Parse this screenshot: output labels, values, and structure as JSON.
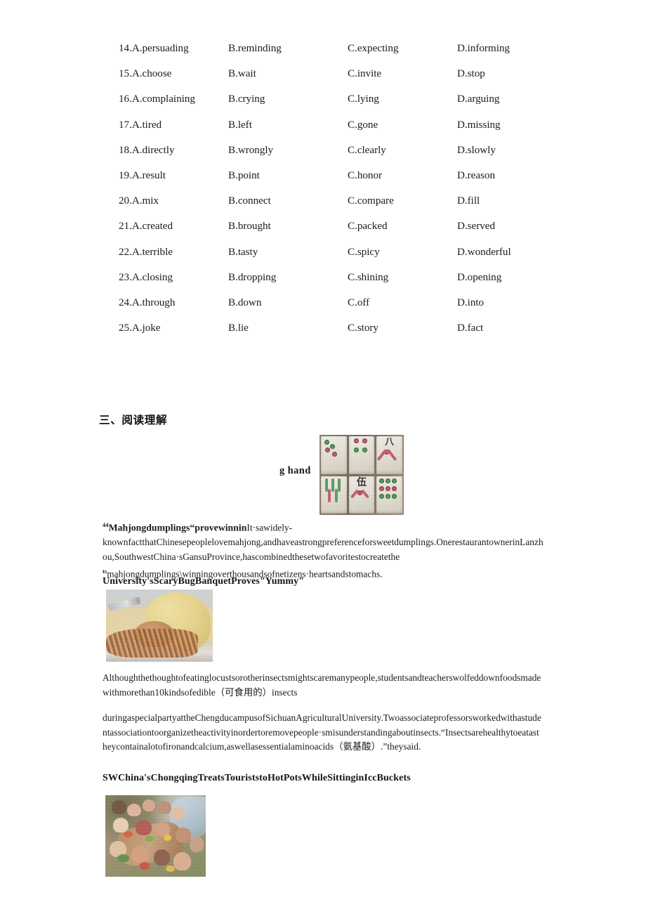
{
  "document": {
    "section_heading": "三、阅读理解"
  },
  "cloze_options": {
    "rows": [
      {
        "a": "14.A.persuading",
        "b": "B.reminding",
        "c": "C.expecting",
        "d": "D.informing"
      },
      {
        "a": "15.A.choose",
        "b": "B.wait",
        "c": "C.invite",
        "d": "D.stop"
      },
      {
        "a": "16.A.complaining",
        "b": "B.crying",
        "c": "C.lying",
        "d": "D.arguing"
      },
      {
        "a": "17.A.tired",
        "b": "B.left",
        "c": "C.gone",
        "d": "D.missing"
      },
      {
        "a": "18.A.directly",
        "b": "B.wrongly",
        "c": "C.clearly",
        "d": "D.slowly"
      },
      {
        "a": "19.A.result",
        "b": "B.point",
        "c": "C.honor",
        "d": "D.reason"
      },
      {
        "a": "20.A.mix",
        "b": "B.connect",
        "c": "C.compare",
        "d": "D.fill"
      },
      {
        "a": "21.A.created",
        "b": "B.brought",
        "c": "C.packed",
        "d": "D.served"
      },
      {
        "a": "22.A.terrible",
        "b": "B.tasty",
        "c": "C.spicy",
        "d": "D.wonderful"
      },
      {
        "a": "23.A.closing",
        "b": "B.dropping",
        "c": "C.shining",
        "d": "D.opening"
      },
      {
        "a": "24.A.through",
        "b": "B.down",
        "c": "C.off",
        "d": "D.into"
      },
      {
        "a": "25.A.joke",
        "b": "B.lie",
        "c": "C.story",
        "d": "D.fact"
      }
    ]
  },
  "articles": {
    "article1": {
      "float_text": "g hand",
      "sup_marker": "44",
      "heading": "Mahjongdumplings“provewinnin",
      "body": "It·sawidely-knownfactthatChinesepeoplelovemahjong,andhaveastrongpreferenceforsweetdumplings.OnerestaurantownerinLanzhou,SouthwestChina·sGansuProvince,hascombinedthesetwofavoritestocreatethe",
      "sup_marker2": "ts",
      "body2": "mahjongdumplings\\winningoverthousandsofnetizens·heartsandstomachs.",
      "image_alt": "mahjong-tiles-photo"
    },
    "article2": {
      "heading": "University'sScaryBugBanquetProves\"Yummy\"",
      "body": "Althoughthethoughtofeatinglocustsorotherinsectsmightscaremanypeople,studentsandteacherswolfeddownfoodsmadewithmorethan10kindsofedible（可食用的）insects",
      "body2": "duringaspecialpartyattheChengducampusofSichuanAgriculturalUniversity.Twoassociateprofessorsworkedwithastudentassociationtoorganizetheactivityinordertoremovepeople·smisunderstandingaboutinsects.“Insectsarehealthytoeatastheycontainalotofironandcalcium,aswellasessentialaminoacids（氨基酸）.”theysaid.",
      "image_alt": "fried-insects-plate-photo"
    },
    "article3": {
      "heading": "SWChina'sChongqingTreatsTouriststoHotPotsWhileSittinginIccBuckets",
      "image_alt": "hotpot-in-ice-buckets-photo"
    }
  },
  "colors": {
    "page_background": "#ffffff",
    "text": "#1c1c1c"
  }
}
